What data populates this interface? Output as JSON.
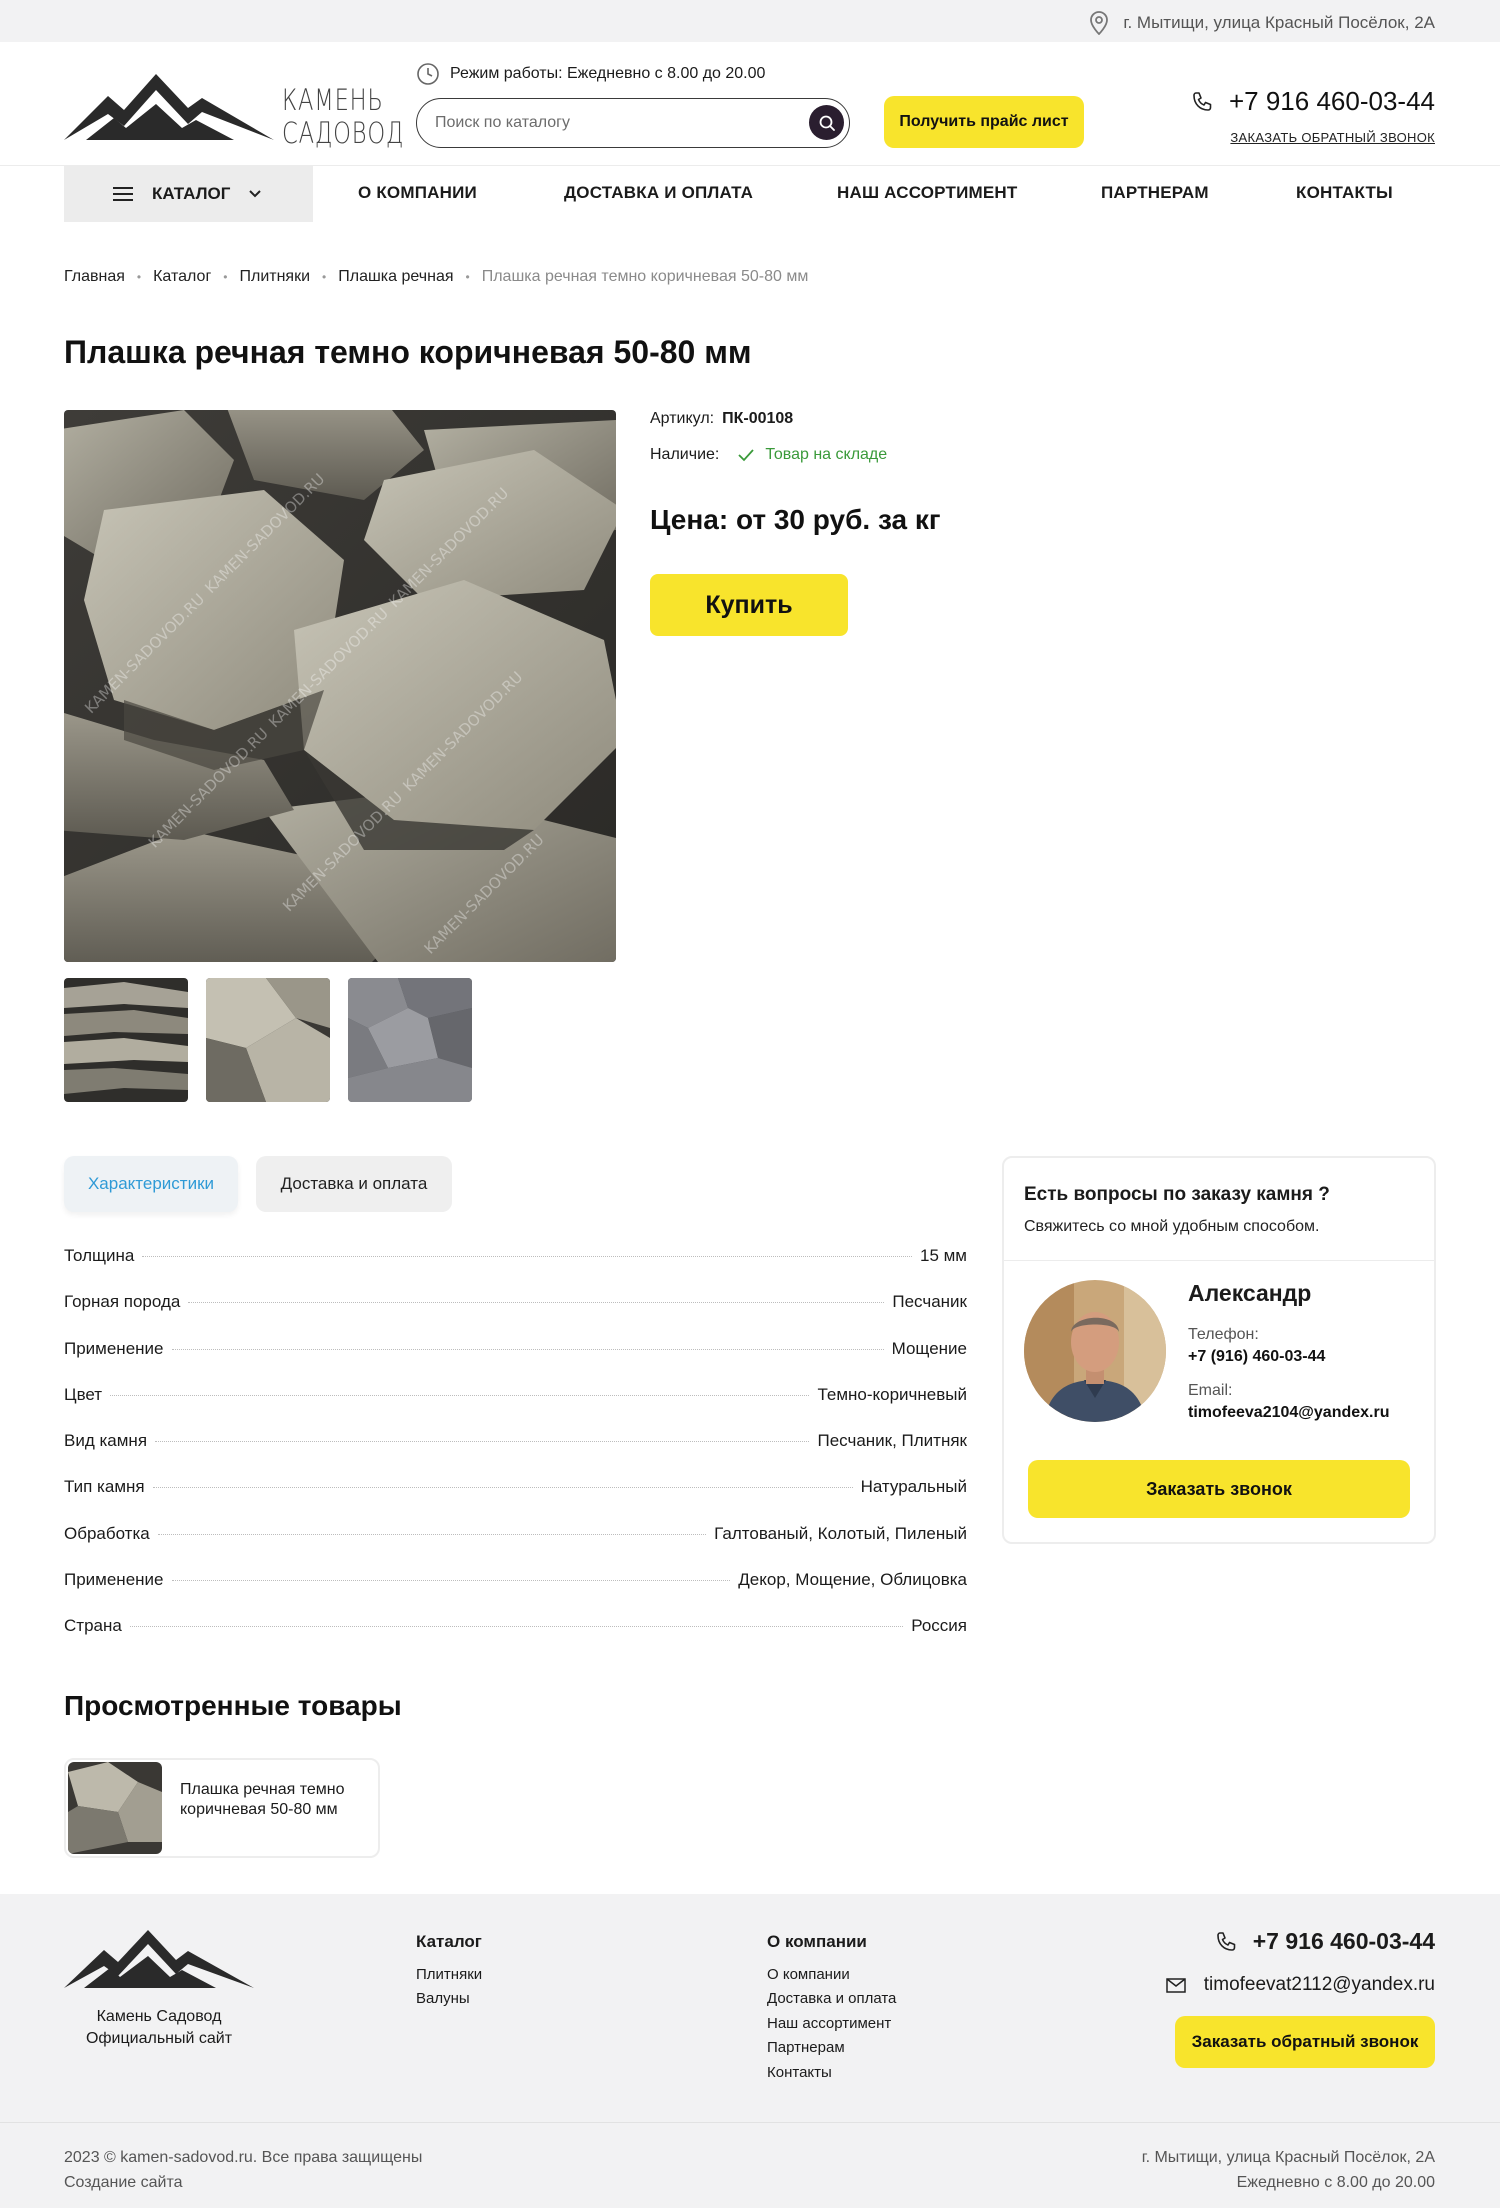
{
  "topbar": {
    "address": "г. Мытищи, улица Красный Посёлок, 2А"
  },
  "header": {
    "logo_line1": "КАМЕНЬ",
    "logo_line2": "САДОВОД",
    "hours": "Режим работы: Ежедневно с 8.00 до 20.00",
    "search_placeholder": "Поиск по каталогу",
    "price_button": "Получить прайс лист",
    "phone": "+7 916 460-03-44",
    "callback_link": "ЗАКАЗАТЬ ОБРАТНЫЙ ЗВОНОК"
  },
  "nav": {
    "catalog": "КАТАЛОГ",
    "items": [
      "О КОМПАНИИ",
      "ДОСТАВКА И ОПЛАТА",
      "НАШ АССОРТИМЕНТ",
      "ПАРТНЕРАМ",
      "КОНТАКТЫ"
    ]
  },
  "breadcrumb": [
    "Главная",
    "Каталог",
    "Плитняки",
    "Плашка речная",
    "Плашка речная темно коричневая 50-80 мм"
  ],
  "product": {
    "title": "Плашка речная темно коричневая 50-80 мм",
    "sku_label": "Артикул:",
    "sku": "ПК-00108",
    "availability_label": "Наличие:",
    "availability": "Товар на складе",
    "price": "Цена: от 30 руб. за кг",
    "buy_button": "Купить",
    "watermark": "KAMEN-SADOVOD.RU"
  },
  "tabs": [
    "Характеристики",
    "Доставка и оплата"
  ],
  "specs": [
    {
      "name": "Толщина",
      "value": "15 мм"
    },
    {
      "name": "Горная порода",
      "value": "Песчаник"
    },
    {
      "name": "Применение",
      "value": "Мощение"
    },
    {
      "name": "Цвет",
      "value": "Темно-коричневый"
    },
    {
      "name": "Вид камня",
      "value": "Песчаник, Плитняк"
    },
    {
      "name": "Тип камня",
      "value": "Натуральный"
    },
    {
      "name": "Обработка",
      "value": "Галтованый, Колотый, Пиленый"
    },
    {
      "name": "Применение",
      "value": "Декор, Мощение, Облицовка"
    },
    {
      "name": "Страна",
      "value": "Россия"
    }
  ],
  "contact_card": {
    "question": "Есть вопросы по заказу камня ?",
    "subtitle": "Свяжитесь со мной удобным способом.",
    "name": "Александр",
    "phone_label": "Телефон:",
    "phone": "+7 (916) 460-03-44",
    "email_label": "Email:",
    "email": "timofeeva2104@yandex.ru",
    "button": "Заказать звонок"
  },
  "viewed": {
    "title": "Просмотренные товары",
    "items": [
      {
        "name": "Плашка речная темно коричневая 50-80 мм"
      }
    ]
  },
  "footer": {
    "brand_line1": "Камень Садовод",
    "brand_line2": "Официальный сайт",
    "catalog_heading": "Каталог",
    "catalog_links": [
      "Плитняки",
      "Валуны"
    ],
    "company_heading": "О компании",
    "company_links": [
      "О компании",
      "Доставка и оплата",
      "Наш ассортимент",
      "Партнерам",
      "Контакты"
    ],
    "phone": "+7 916 460-03-44",
    "email": "timofeevat2112@yandex.ru",
    "callback_button": "Заказать обратный звонок",
    "copyright": "2023 © kamen-sadovod.ru. Все права защищены",
    "made_by": "Создание сайта",
    "address": "г. Мытищи, улица Красный Посёлок, 2А",
    "hours": "Ежедневно с 8.00 до 20.00"
  },
  "colors": {
    "accent": "#f8e42c",
    "tab_active": "#2f9ad6",
    "in_stock": "#3a9a3a",
    "search_button": "#2a1e2f"
  }
}
